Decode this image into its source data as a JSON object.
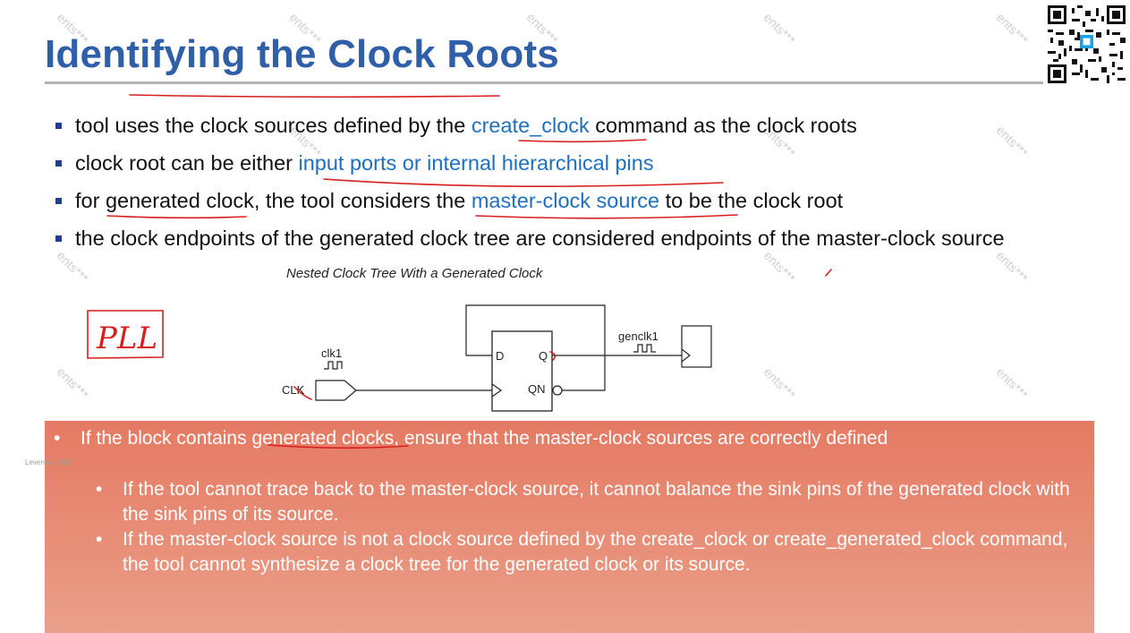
{
  "title": "Identifying the Clock Roots",
  "bullets": [
    {
      "pre": "tool uses the clock sources defined by the ",
      "hl": "create_clock",
      "post": " command as the clock roots"
    },
    {
      "pre": "clock root can be either ",
      "hl": "input ports or internal hierarchical pins",
      "post": ""
    },
    {
      "pre": "for generated clock, the tool considers the ",
      "hl": "master-clock source",
      "post": " to be the clock root"
    },
    {
      "pre": "the clock endpoints of the generated clock tree are considered endpoints of the master-clock source",
      "hl": "",
      "post": ""
    }
  ],
  "diagram": {
    "caption": "Nested Clock Tree With a Generated Clock",
    "clk_in_label": "clk1",
    "port_label": "CLK",
    "d_label": "D",
    "q_label": "Q",
    "qn_label": "QN",
    "genclk_label": "genclk1"
  },
  "callout": {
    "main": "If the block contains generated clocks, ensure that the master-clock sources are correctly defined",
    "subs": [
      "If the tool cannot trace back to the master-clock source, it cannot balance the sink pins of the generated clock with the sink pins of its source.",
      "If the master-clock source is not a clock source defined by the create_clock or create_generated_clock command, the tool cannot synthesize a clock tree for the generated clock or its source."
    ]
  },
  "annotation_text": "PLL",
  "watermark": "ents***",
  "watermark_small": "Leventsai2023",
  "colors": {
    "title": "#2e5fa8",
    "highlight": "#1f6fc0",
    "callout": "#e57a64",
    "pen": "#d81e1e"
  }
}
